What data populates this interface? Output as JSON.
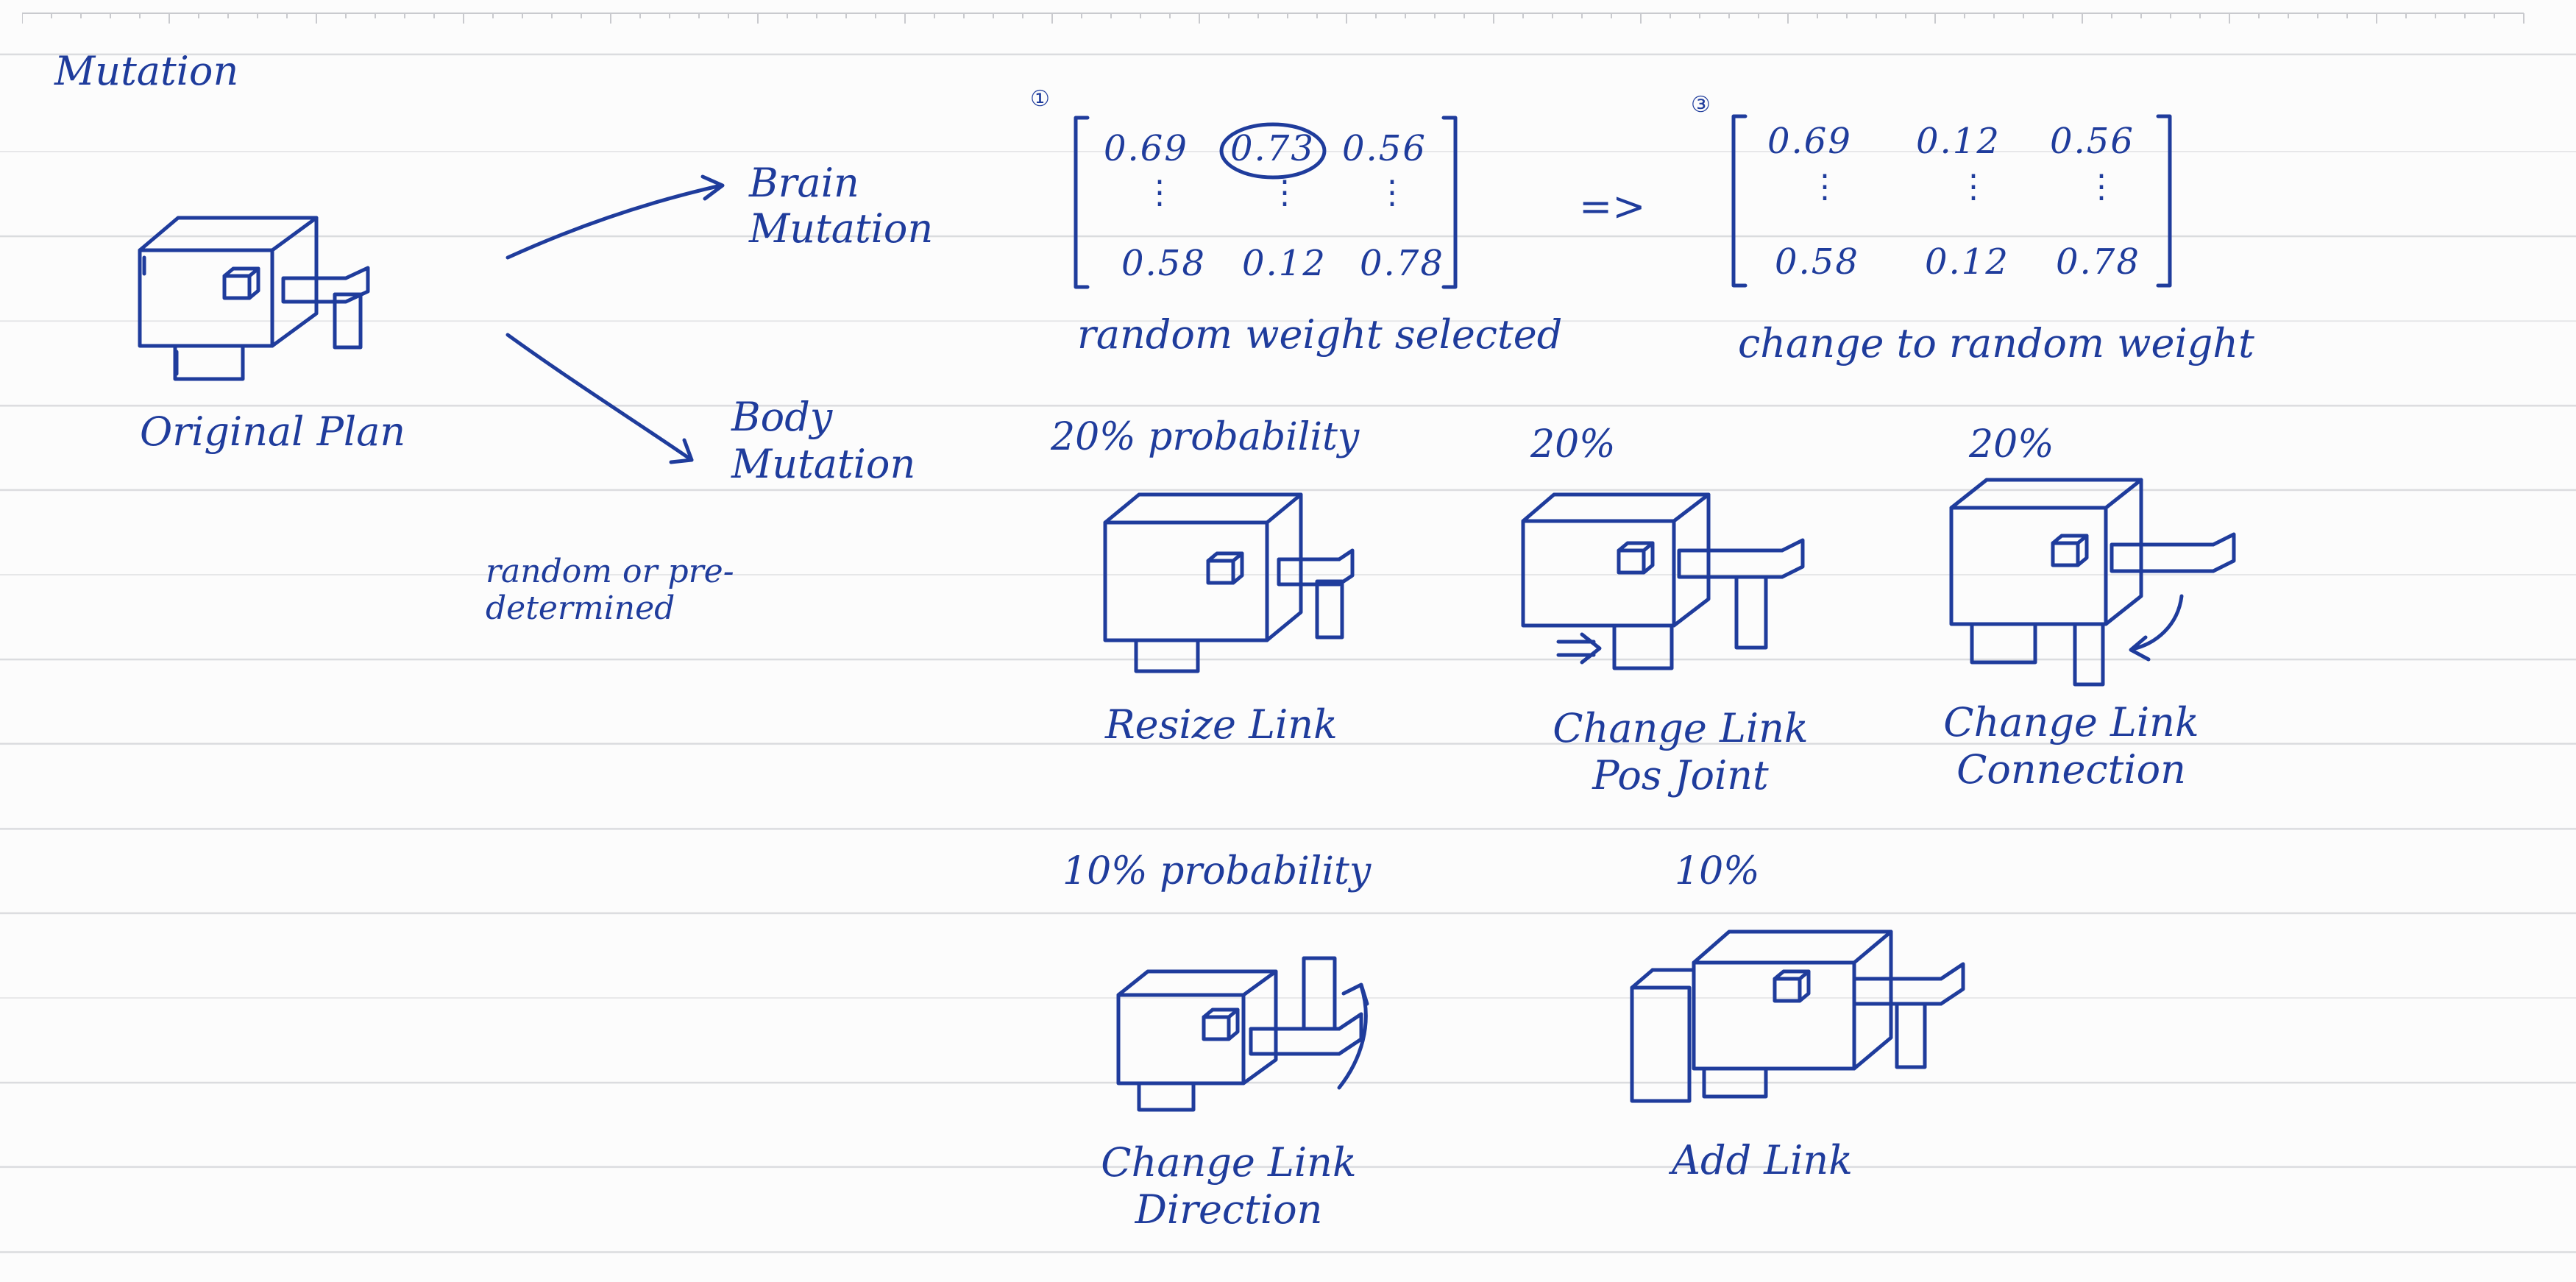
{
  "title": "Mutation",
  "original": {
    "label": "Original Plan"
  },
  "arrows": {
    "brain": "Brain Mutation",
    "body": "Body Mutation"
  },
  "selection_note": "random or pre-determined",
  "brain_mutation": {
    "step1": {
      "marker": "①",
      "caption": "random weight selected",
      "matrix": [
        [
          "0.69",
          "0.73",
          "0.56"
        ],
        [
          "0.58",
          "0.12",
          "0.78"
        ]
      ],
      "circled": "0.73"
    },
    "implies": "=>",
    "step3": {
      "marker": "③",
      "caption": "change to random weight",
      "matrix": [
        [
          "0.69",
          "0.12",
          "0.56"
        ],
        [
          "0.58",
          "0.12",
          "0.78"
        ]
      ]
    }
  },
  "body_mutations": [
    {
      "probability": "20% probability",
      "label": "Resize Link"
    },
    {
      "probability": "20%",
      "label": "Change Link Pos Joint"
    },
    {
      "probability": "20%",
      "label": "Change Link Connection"
    },
    {
      "probability": "10% probability",
      "label": "Change Link Direction"
    },
    {
      "probability": "10%",
      "label": "Add Link"
    }
  ],
  "colors": {
    "ink": "#1f3c9c",
    "rule": "#d9dadd",
    "paper": "#fcfcfc"
  }
}
